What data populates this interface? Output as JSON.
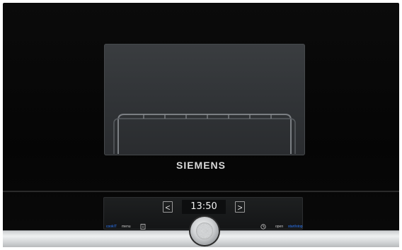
{
  "brand": "SIEMENS",
  "display": {
    "time": "13:50",
    "prev_label": "<",
    "next_label": ">"
  },
  "controls": {
    "left": [
      {
        "id": "mode",
        "label": "cookIT",
        "accent": true
      },
      {
        "id": "menu",
        "label": "menu",
        "accent": false
      }
    ],
    "right": [
      {
        "id": "open",
        "label": "open",
        "accent": false
      },
      {
        "id": "start",
        "label": "start/stop",
        "accent": true
      }
    ]
  },
  "colors": {
    "accent": "#2e7cff",
    "body": "#0b0b0b",
    "steel": "#d3d5d7"
  },
  "icons": [
    "info-icon",
    "clock-icon",
    "rotary-knob"
  ]
}
